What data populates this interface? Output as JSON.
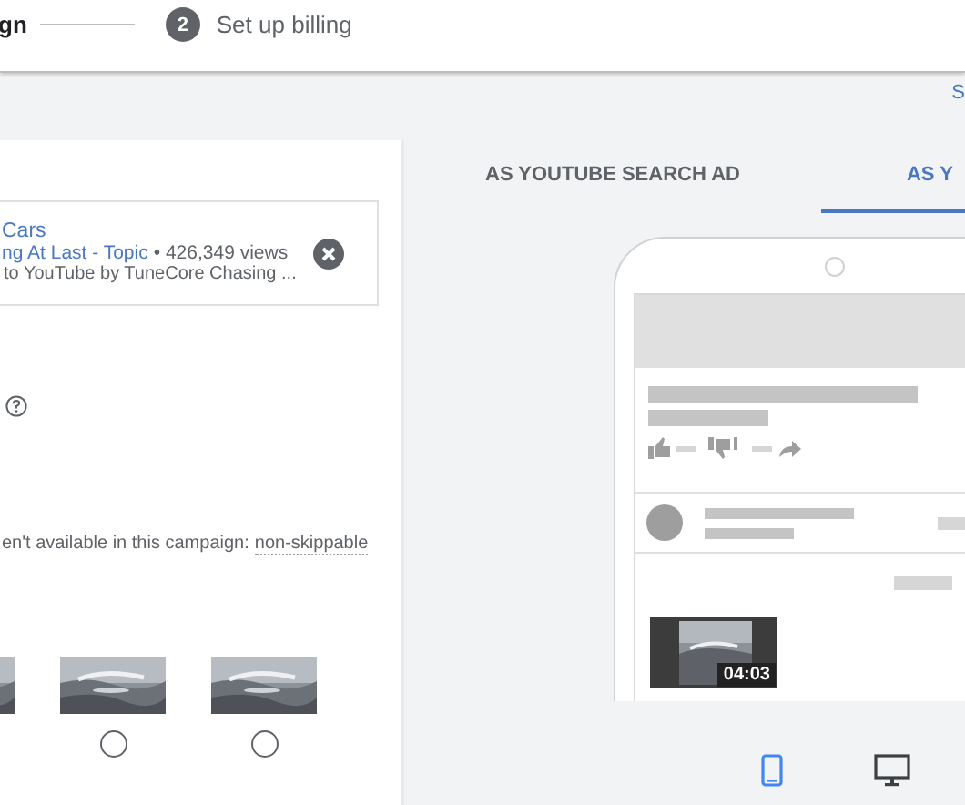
{
  "stepper": {
    "previous_label": "gn",
    "steps": [
      {
        "number": "2",
        "label": "Set up billing"
      }
    ]
  },
  "subbar": {
    "link": "S"
  },
  "video_card": {
    "title": "Cars",
    "channel": "ng At Last - Topic",
    "views": "• 426,349 views",
    "description": "to YouTube by TuneCore Chasing ..."
  },
  "notice": {
    "text": "en't available in this campaign:",
    "link": "non-skippable"
  },
  "thumbnails": [
    {
      "kind": "partial"
    },
    {
      "kind": "option",
      "selected": false
    },
    {
      "kind": "option",
      "selected": false
    }
  ],
  "preview": {
    "tabs": [
      {
        "label": "AS YOUTUBE SEARCH AD",
        "selected": false
      },
      {
        "label": "AS Y",
        "selected": true
      }
    ],
    "video_duration": "04:03",
    "devices": [
      {
        "kind": "mobile",
        "selected": true
      },
      {
        "kind": "desktop",
        "selected": false
      }
    ]
  }
}
